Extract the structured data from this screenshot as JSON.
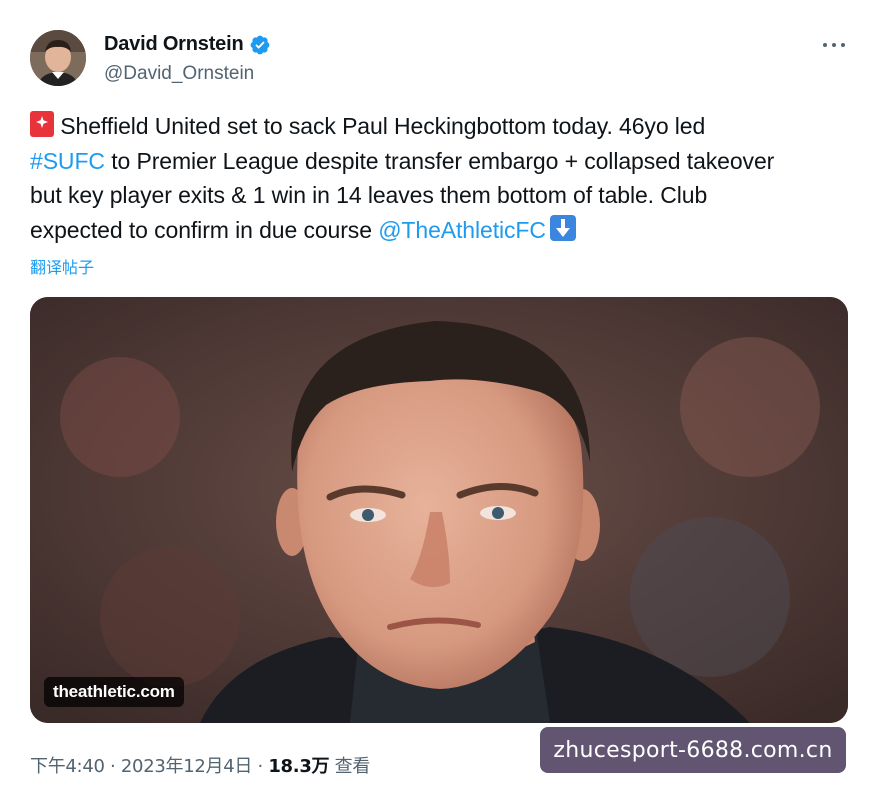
{
  "author": {
    "display_name": "David Ornstein",
    "handle": "@David_Ornstein",
    "verified": true,
    "verified_color": "#1d9bf0"
  },
  "tweet": {
    "line1_text": " Sheffield United set to sack Paul Heckingbottom today. 46yo led",
    "hashtag": "#SUFC",
    "line2_text": " to Premier League despite transfer embargo + collapsed takeover",
    "line3_text": "but key player exits & 1 win in 14 leaves them bottom of table. Club",
    "line4_text": "expected to confirm in due course ",
    "mention": "@TheAthleticFC",
    "leading_emoji": "police-siren-icon",
    "trailing_emoji": "down-arrow-icon",
    "translate_label": "翻译帖子"
  },
  "media": {
    "source_label": "theathletic.com"
  },
  "meta": {
    "time": "下午4:40",
    "separator": " · ",
    "date": "2023年12月4日",
    "views_count": "18.3万",
    "views_label": " 查看"
  },
  "watermark": {
    "text": "zhucesport-6688.com.cn"
  },
  "colors": {
    "link": "#1d9bf0",
    "secondary_text": "#536471",
    "primary_text": "#0f1419"
  }
}
